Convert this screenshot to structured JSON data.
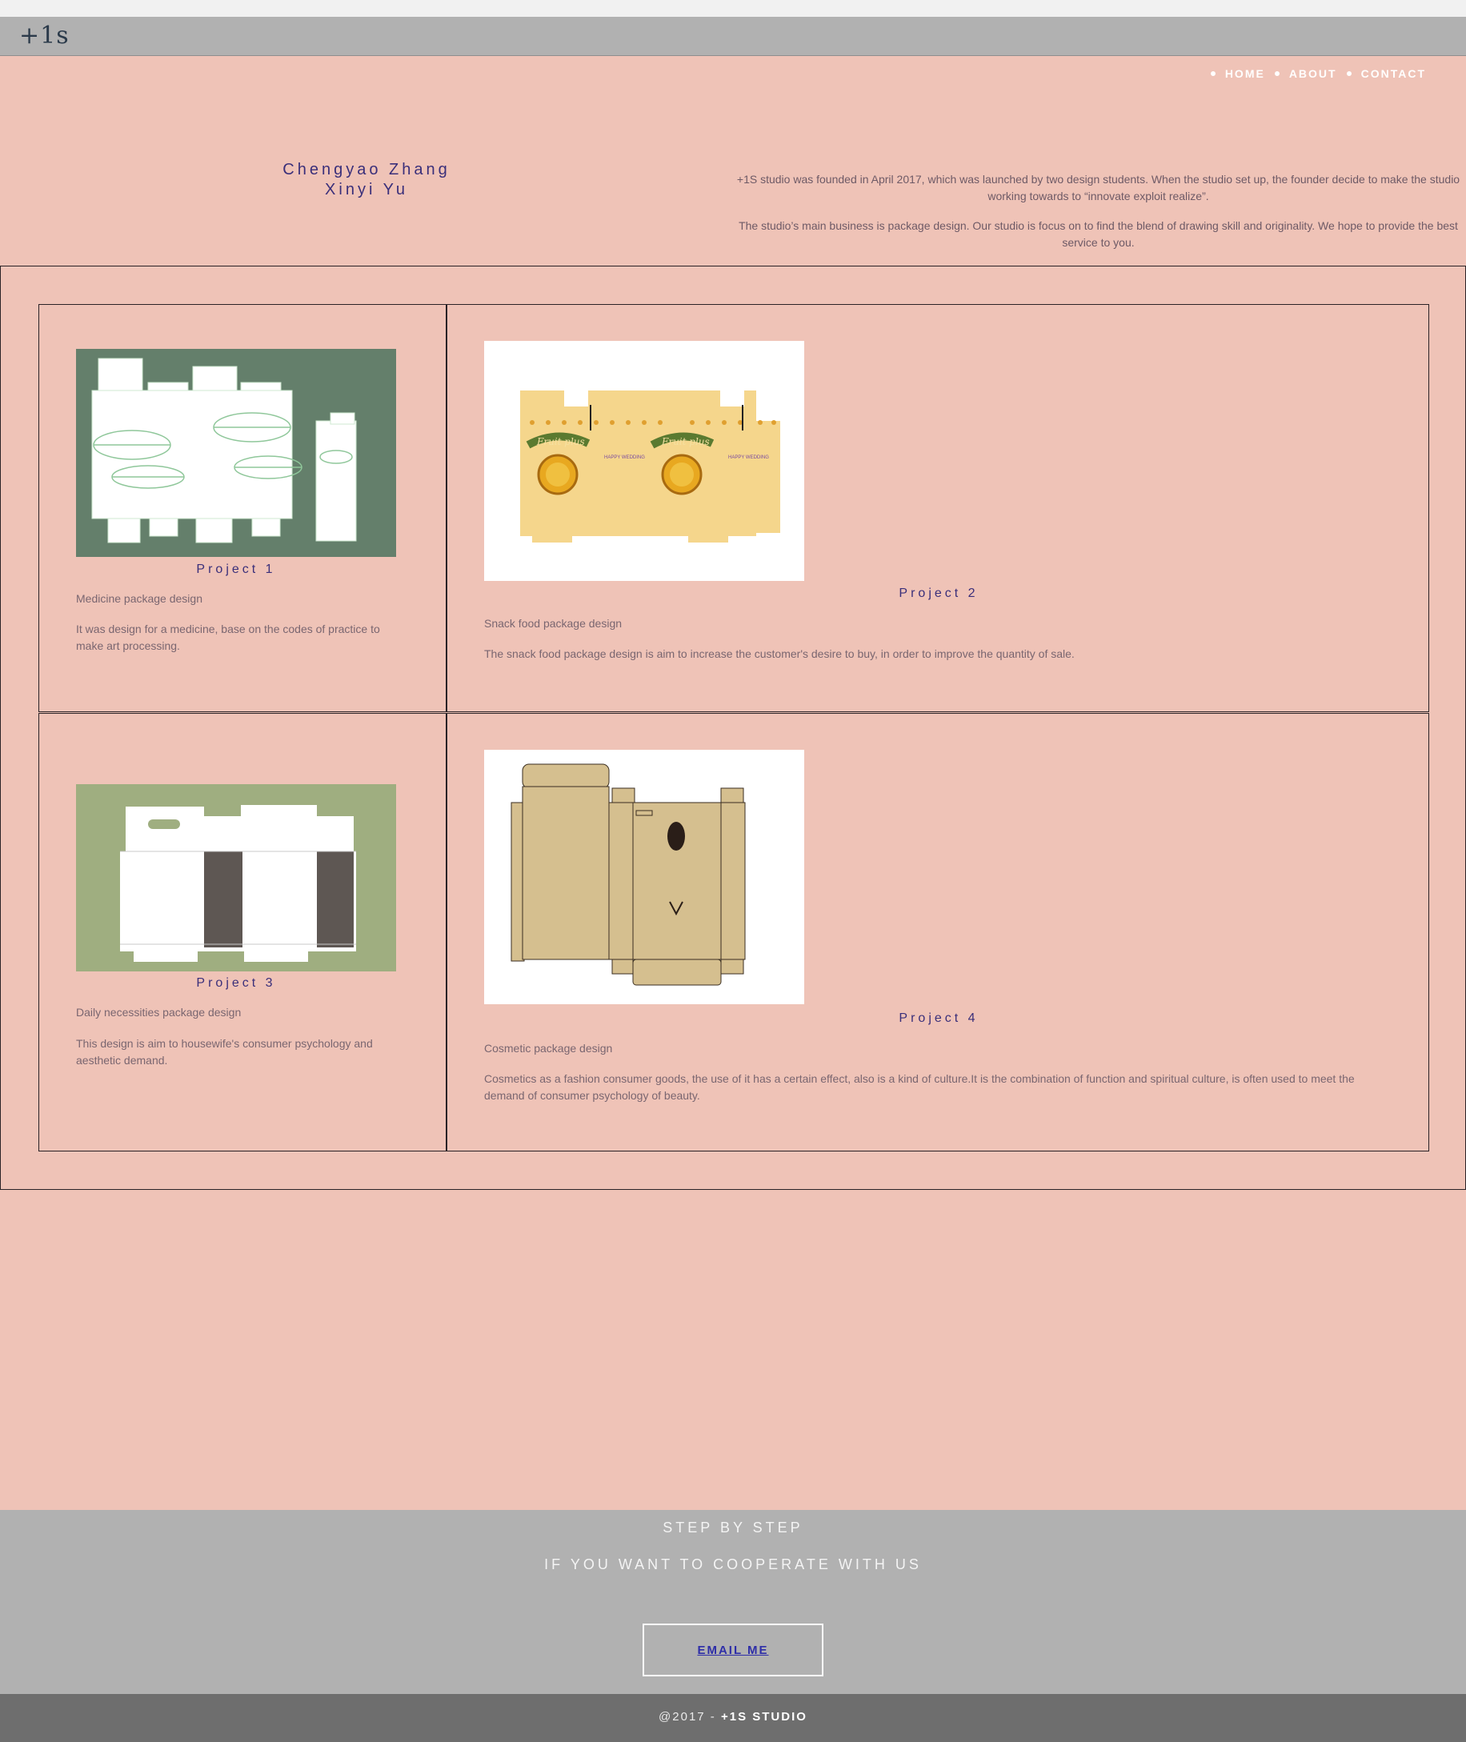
{
  "header": {
    "logo": "+1s"
  },
  "nav": {
    "items": [
      "HOME",
      "ABOUT",
      "CONTACT"
    ]
  },
  "intro": {
    "names": [
      "Chengyao Zhang",
      "Xinyi Yu"
    ],
    "paragraphs": [
      "+1S studio was founded in April 2017, which was launched by two design students. When the studio set up, the founder decide to make the studio working towards to “innovate exploit realize”.",
      "The studio’s main business is package design. Our studio is focus on to find the blend of drawing skill and originality. We hope to provide the best service to you."
    ]
  },
  "projects": [
    {
      "title": "Project 1",
      "subtitle": "Medicine package design",
      "description": "It was design for a medicine, base on the codes of practice to make art processing.",
      "image": "medicine-package-dieline"
    },
    {
      "title": "Project 2",
      "subtitle": "Snack food package design",
      "description": "The snack food package design is aim to increase the customer's desire to buy, in order to improve the quantity of sale.",
      "image": "fruit-plus-package-dieline",
      "brand_text": "Fruit plus",
      "side_text": "HAPPY WEDDING"
    },
    {
      "title": "Project 3",
      "subtitle": "Daily necessities package design",
      "description": "This design is aim to housewife's consumer psychology and aesthetic demand.",
      "image": "daily-necessities-package-dieline"
    },
    {
      "title": "Project 4",
      "subtitle": "Cosmetic package design",
      "description": "Cosmetics as a fashion consumer goods, the use of it has a certain effect, also is a kind of culture.It is the combination of function and spiritual culture, is often used to meet the demand of consumer psychology of beauty.",
      "image": "cosmetic-package-dieline"
    }
  ],
  "cta": {
    "line1": "STEP BY STEP",
    "line2": "IF YOU WANT TO COOPERATE WITH US",
    "button": "EMAIL ME"
  },
  "footer": {
    "prefix": "@2017 - ",
    "brand": "+1S STUDIO"
  },
  "colors": {
    "page_bg": "#efc3b7",
    "header_bg": "#b1b1b1",
    "footer_bg": "#6e6e6e",
    "title_color": "#3a2f7a",
    "project1_bg": "#647f6b",
    "project3_bg": "#9fae80"
  }
}
